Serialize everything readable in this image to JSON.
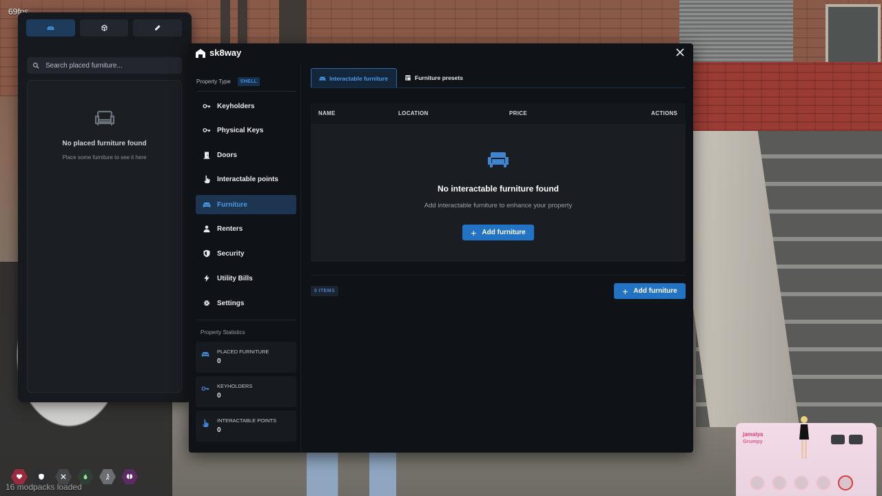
{
  "hud": {
    "fps": "69fps",
    "loaded_text": "16 modpacks loaded"
  },
  "left_panel": {
    "search_placeholder": "Search placed furniture...",
    "empty_title": "No placed furniture found",
    "empty_subtitle": "Place some furniture to see it here"
  },
  "modal": {
    "title": "sk8way",
    "property_type_label": "Property Type",
    "property_type_value": "SHELL",
    "sidebar": {
      "items": [
        {
          "label": "Keyholders",
          "icon": "key-icon"
        },
        {
          "label": "Physical Keys",
          "icon": "key-icon"
        },
        {
          "label": "Doors",
          "icon": "door-icon"
        },
        {
          "label": "Interactable points",
          "icon": "pointer-icon"
        },
        {
          "label": "Furniture",
          "icon": "couch-icon",
          "active": true
        },
        {
          "label": "Renters",
          "icon": "user-icon"
        },
        {
          "label": "Security",
          "icon": "shield-icon"
        },
        {
          "label": "Utility Bills",
          "icon": "bolt-icon"
        },
        {
          "label": "Settings",
          "icon": "gear-icon"
        }
      ],
      "stats_title": "Property Statistics",
      "stats": [
        {
          "label": "PLACED FURNITURE",
          "value": "0"
        },
        {
          "label": "KEYHOLDERS",
          "value": "0"
        },
        {
          "label": "INTERACTABLE POINTS",
          "value": "0"
        }
      ]
    },
    "tabs": [
      {
        "label": "Interactable furniture",
        "active": true
      },
      {
        "label": "Furniture presets",
        "active": false
      }
    ],
    "table": {
      "columns": [
        "NAME",
        "LOCATION",
        "PRICE",
        "ACTIONS"
      ],
      "empty_title": "No interactable furniture found",
      "empty_subtitle": "Add interactable furniture to enhance your property",
      "add_button": "Add furniture"
    },
    "footer": {
      "items_count": "0 ITEMS",
      "add_button": "Add furniture"
    }
  },
  "phone": {
    "name": "jamaiya",
    "status": "Grumpy"
  },
  "colors": {
    "accent": "#2373c5",
    "active_text": "#4a9ae6",
    "panel_bg": "#0f1216"
  }
}
